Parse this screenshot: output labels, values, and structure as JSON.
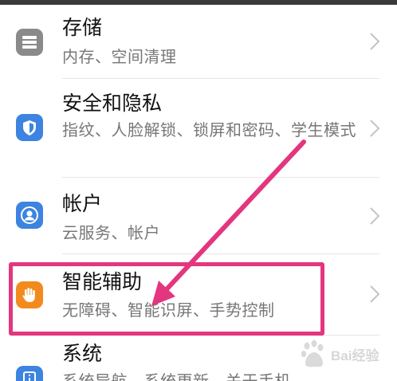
{
  "settings": {
    "items": [
      {
        "title": "存储",
        "subtitle": "内存、空间清理",
        "icon": "storage-icon",
        "color": "#8a8a8a"
      },
      {
        "title": "安全和隐私",
        "subtitle": "指纹、人脸解锁、锁屏和密码、学生模式",
        "icon": "shield-icon",
        "color": "#3d83e0"
      },
      {
        "title": "帐户",
        "subtitle": "云服务、帐户",
        "icon": "account-icon",
        "color": "#3d83e0"
      },
      {
        "title": "智能辅助",
        "subtitle": "无障碍、智能识屏、手势控制",
        "icon": "hand-icon",
        "color": "#f28a1e"
      },
      {
        "title": "系统",
        "subtitle": "系统导航、系统更新、关于手机",
        "icon": "system-info-icon",
        "color": "#3d83e0"
      }
    ]
  },
  "annotation": {
    "color": "#e3367e",
    "highlighted_item": "智能辅助"
  },
  "watermark": {
    "text": "Bai经验"
  }
}
